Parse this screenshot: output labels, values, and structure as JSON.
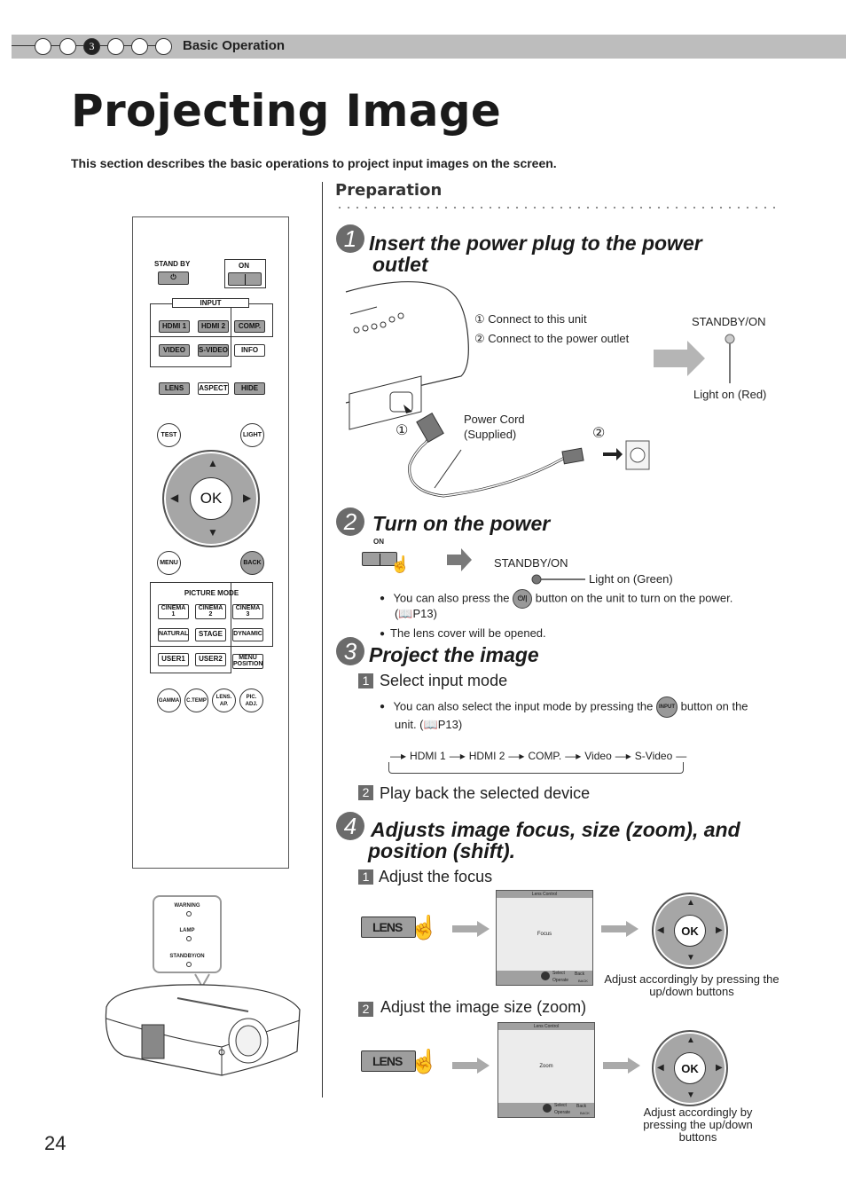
{
  "header": {
    "chapter_steps": [
      "",
      "",
      "3",
      "",
      "",
      ""
    ],
    "active_chapter": 3,
    "section": "Basic Operation"
  },
  "title": "Projecting Image",
  "intro": "This section describes the basic operations to project input images on the screen.",
  "remote": {
    "standby_label": "STAND BY",
    "on_label": "ON",
    "input_label": "INPUT",
    "input_buttons": [
      "HDMI 1",
      "HDMI 2",
      "COMP.",
      "VIDEO",
      "S-VIDEO",
      "INFO"
    ],
    "row3": [
      "LENS",
      "ASPECT",
      "HIDE"
    ],
    "test": "TEST",
    "light": "LIGHT",
    "ok": "OK",
    "menu": "MENU",
    "back": "BACK",
    "picture_mode_label": "PICTURE MODE",
    "picture_modes": [
      "CINEMA 1",
      "CINEMA 2",
      "CINEMA 3",
      "NATURAL",
      "STAGE",
      "DYNAMIC",
      "USER1",
      "USER2",
      "MENU POSITION"
    ],
    "bottom_circles": [
      "GAMMA",
      "C.TEMP",
      "LENS. AP.",
      "PIC. ADJ."
    ]
  },
  "projector_panel": {
    "indicators": [
      "WARNING",
      "LAMP",
      "STANDBY/ON"
    ]
  },
  "preparation": "Preparation",
  "steps": [
    {
      "num": "1",
      "title_line1": "Insert the power plug to the power",
      "title_line2": "outlet",
      "connect1": "① Connect to this unit",
      "connect2": "② Connect to the power outlet",
      "standby_on": "STANDBY/ON",
      "light": "Light on (Red)",
      "cord_line1": "Power Cord",
      "cord_line2": "(Supplied)",
      "marker1": "①",
      "marker2": "②",
      "light_color": "#ff0000"
    },
    {
      "num": "2",
      "title": "Turn on the power",
      "on_label": "ON",
      "standby_on": "STANDBY/ON",
      "light": "Light on (Green)",
      "bullet1_a": "You can also press the",
      "bullet1_icon": "⏻/|",
      "bullet1_b": "button on the unit to turn on the power.",
      "bullet1_ref": "(📖P13)",
      "bullet2": "The lens cover will be opened."
    },
    {
      "num": "3",
      "title": "Project the image",
      "sub1_num": "1",
      "sub1": "Select input mode",
      "bullet_a": "You can also select the input mode by pressing the",
      "bullet_icon": "INPUT",
      "bullet_b": "button on the",
      "bullet_c": "unit. (📖P13)",
      "cycle": [
        "HDMI 1",
        "HDMI 2",
        "COMP.",
        "Video",
        "S-Video"
      ],
      "sub2_num": "2",
      "sub2": "Play back the selected device"
    },
    {
      "num": "4",
      "title_line1": "Adjusts image focus, size (zoom), and",
      "title_line2": "position (shift).",
      "sub1_num": "1",
      "sub1": "Adjust the focus",
      "sub2_num": "2",
      "sub2": "Adjust the image size (zoom)",
      "lens_button": "LENS",
      "osd_title": "Lens Control",
      "osd_focus": "Focus",
      "osd_zoom": "Zoom",
      "osd_select": "Select",
      "osd_operate": "Operate",
      "osd_back": "Back",
      "osd_back_key": "BACK",
      "ok": "OK",
      "caption1": "Adjust accordingly by pressing the up/down buttons",
      "caption2": "Adjust accordingly by pressing the up/down buttons"
    }
  ],
  "page_number": "24"
}
